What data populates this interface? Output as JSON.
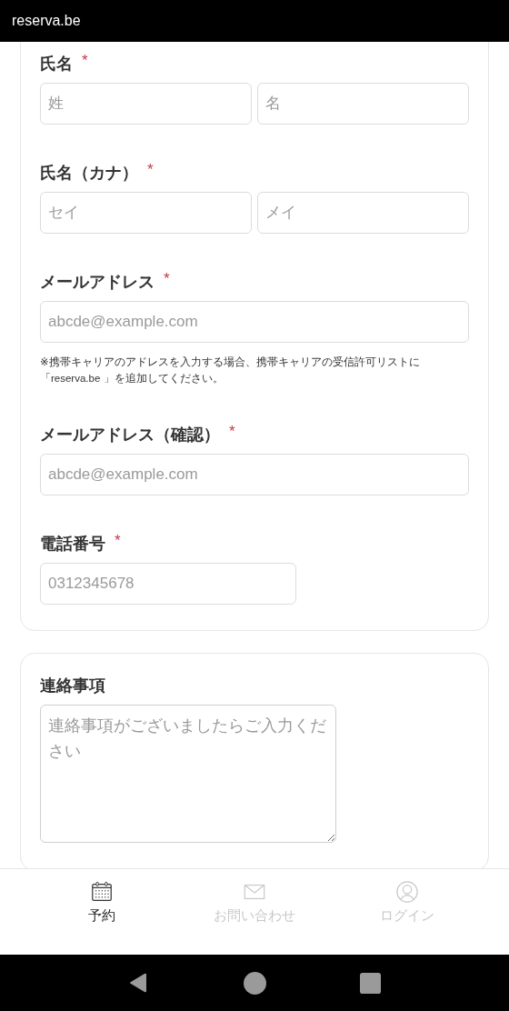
{
  "browser_bar": {
    "title": "reserva.be"
  },
  "form_fields": [
    {
      "kind": "pair",
      "label": "氏名",
      "required_mark": "*",
      "placeholders": [
        "姓",
        "名"
      ]
    },
    {
      "kind": "pair",
      "label": "氏名（カナ）",
      "required_mark": "*",
      "placeholders": [
        "セイ",
        "メイ"
      ]
    },
    {
      "kind": "full",
      "label": "メールアドレス",
      "required_mark": "*",
      "placeholders": [
        "abcde@example.com"
      ],
      "note": "※携帯キャリアのアドレスを入力する場合、携帯キャリアの受信許可リストに「reserva.be 」を追加してください。"
    },
    {
      "kind": "full",
      "label": "メールアドレス（確認）",
      "required_mark": "*",
      "placeholders": [
        "abcde@example.com"
      ]
    },
    {
      "kind": "short",
      "label": "電話番号",
      "required_mark": "*",
      "placeholders": [
        "0312345678"
      ]
    }
  ],
  "notes_section": {
    "label": "連絡事項",
    "placeholder": "連絡事項がございましたらご入力ください"
  },
  "bottom_nav": [
    {
      "kind": "calendar",
      "label": "予約",
      "selected": true
    },
    {
      "kind": "mail",
      "label": "お問い合わせ",
      "selected": false
    },
    {
      "kind": "user",
      "label": "ログイン",
      "selected": false
    }
  ]
}
